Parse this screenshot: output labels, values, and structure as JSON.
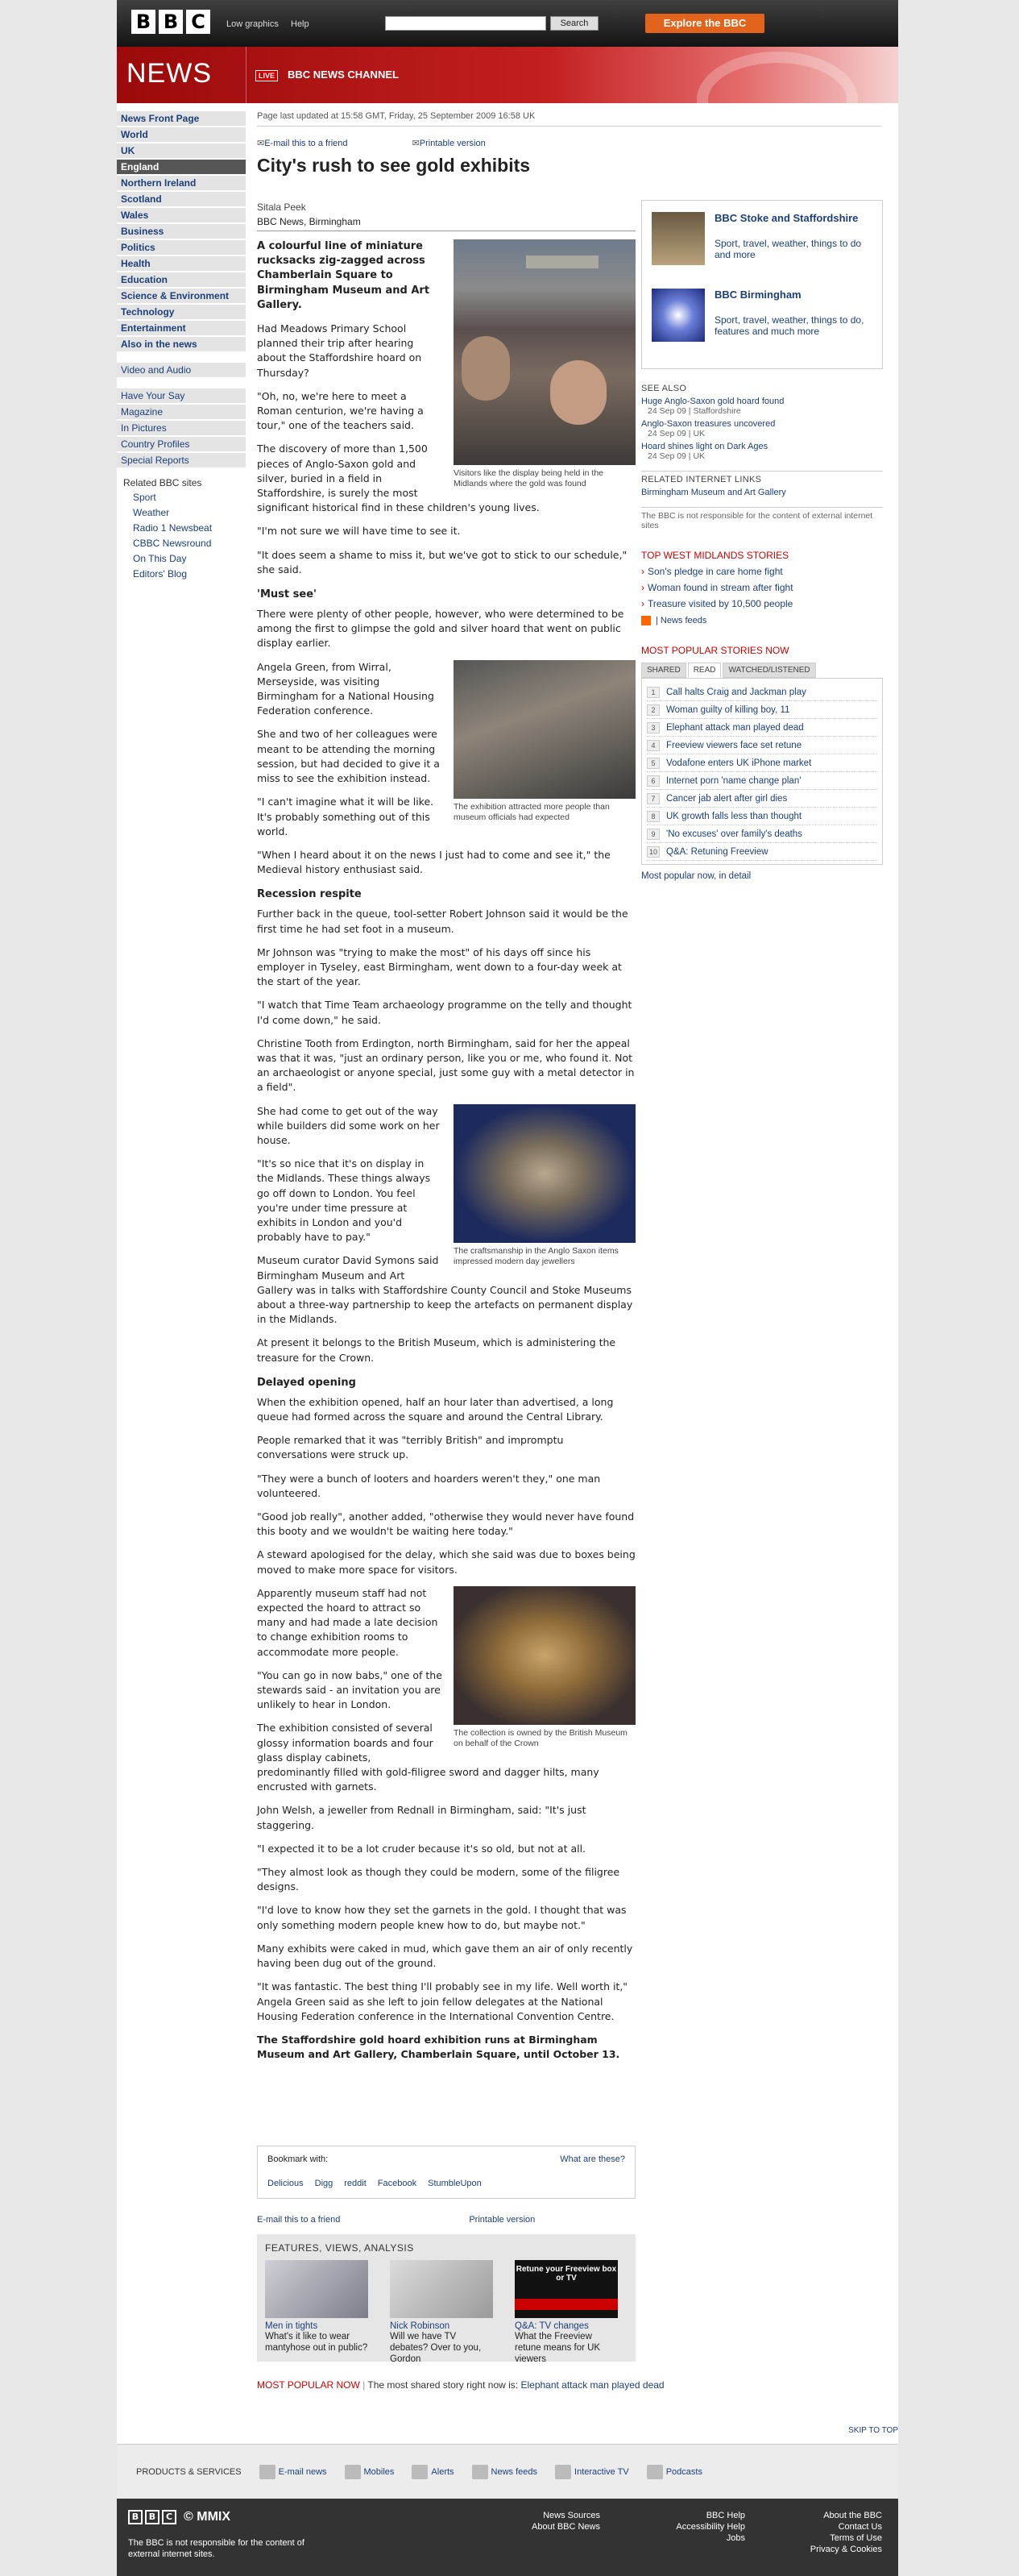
{
  "masthead": {
    "low_graphics": "Low graphics",
    "help": "Help",
    "search_label": "Search",
    "explore": "Explore the BBC"
  },
  "banner": {
    "title": "NEWS",
    "live": "LIVE",
    "channel": "BBC NEWS CHANNEL"
  },
  "nav": {
    "items": [
      "News Front Page",
      "World",
      "UK",
      "England",
      "Northern Ireland",
      "Scotland",
      "Wales",
      "Business",
      "Politics",
      "Health",
      "Education",
      "Science & Environment",
      "Technology",
      "Entertainment",
      "Also in the news"
    ],
    "video": "Video and Audio",
    "secondary": [
      "Have Your Say",
      "Magazine",
      "In Pictures",
      "Country Profiles",
      "Special Reports"
    ],
    "related_header": "Related BBC sites",
    "related": [
      "Sport",
      "Weather",
      "Radio 1 Newsbeat",
      "CBBC Newsround",
      "On This Day",
      "Editors' Blog"
    ]
  },
  "article": {
    "updated": "Page last updated at 15:58 GMT, Friday, 25 September 2009 16:58 UK",
    "email": "E-mail this to a friend",
    "printable": "Printable version",
    "headline": "City's rush to see gold exhibits",
    "author": "Sitala Peek",
    "source": "BBC News, Birmingham",
    "intro": "A colourful line of miniature rucksacks zig-zagged across Chamberlain Square to Birmingham Museum and Art Gallery.",
    "p": [
      "Had Meadows Primary School planned their trip after hearing about the Staffordshire hoard on Thursday?",
      "\"Oh, no, we're here to meet a Roman centurion, we're having a tour,\" one of the teachers said.",
      "The discovery of more than 1,500 pieces of Anglo-Saxon gold and silver, buried in a field in Staffordshire, is surely the most significant historical find in these children's young lives.",
      "\"I'm not sure we will have time to see it.",
      "\"It does seem a shame to miss it, but we've got to stick to our schedule,\" she said."
    ],
    "h1": "'Must see'",
    "p2": [
      "There were plenty of other people, however, who were determined to be among the first to glimpse the gold and silver hoard that went on public display earlier.",
      "Angela Green, from Wirral, Merseyside, was visiting Birmingham for a National Housing Federation conference.",
      "She and two of her colleagues were meant to be attending the morning session, but had decided to give it a miss to see the exhibition instead.",
      "\"I can't imagine what it will be like. It's probably something out of this world.",
      "\"When I heard about it on the news I just had to come and see it,\" the Medieval history enthusiast said."
    ],
    "h2": "Recession respite",
    "p3": [
      "Further back in the queue, tool-setter Robert Johnson said it would be the first time he had set foot in a museum.",
      "Mr Johnson was \"trying to make the most\" of his days off since his employer in Tyseley, east Birmingham, went down to a four-day week at the start of the year.",
      "\"I watch that Time Team archaeology programme on the telly and thought I'd come down,\" he said.",
      "Christine Tooth from Erdington, north Birmingham, said for her the appeal was that it was, \"just an ordinary person, like you or me, who found it. Not an archaeologist or anyone special, just some guy with a metal detector in a field\".",
      "She had come to get out of the way while builders did some work on her house.",
      "\"It's so nice that it's on display in the Midlands. These things always go off down to London. You feel you're under time pressure at exhibits in London and you'd probably have to pay.\"",
      "Museum curator David Symons said Birmingham Museum and Art Gallery was in talks with Staffordshire County Council and Stoke Museums about a three-way partnership to keep the artefacts on permanent display in the Midlands.",
      "At present it belongs to the British Museum, which is administering the treasure for the Crown."
    ],
    "h3": "Delayed opening",
    "p4": [
      "When the exhibition opened, half an hour later than advertised, a long queue had formed across the square and around the Central Library.",
      "People remarked that it was \"terribly British\" and impromptu conversations were struck up.",
      "\"They were a bunch of looters and hoarders weren't they,\" one man volunteered.",
      "\"Good job really\", another added, \"otherwise they would never have found this booty and we wouldn't be waiting here today.\"",
      "A steward apologised for the delay, which she said was due to boxes being moved to make more space for visitors.",
      "Apparently museum staff had not expected the hoard to attract so many and had made a late decision to change exhibition rooms to accommodate more people.",
      "\"You can go in now babs,\" one of the stewards said - an invitation you are unlikely to hear in London.",
      "The exhibition consisted of several glossy information boards and four glass display cabinets, predominantly filled with gold-filigree sword and dagger hilts, many encrusted with garnets.",
      "John Welsh, a jeweller from Rednall in Birmingham, said: \"It's just staggering.",
      "\"I expected it to be a lot cruder because it's so old, but not at all.",
      "\"They almost look as though they could be modern, some of the filigree designs.",
      "\"I'd love to know how they set the garnets in the gold. I thought that was only something modern people knew how to do, but maybe not.\"",
      "Many exhibits were caked in mud, which gave them an air of only recently having been dug out of the ground.",
      "\"It was fantastic. The best thing I'll probably see in my life. Well worth it,\" Angela Green said as she left to join fellow delegates at the National Housing Federation conference in the International Convention Centre."
    ],
    "last": "The Staffordshire gold hoard exhibition runs at Birmingham Museum and Art Gallery, Chamberlain Square, until October 13.",
    "captions": [
      "Visitors like the display being held in the Midlands where the gold was found",
      "The exhibition attracted more people than museum officials had expected",
      "The craftsmanship in the Anglo Saxon items impressed modern day jewellers",
      "The collection is owned by the British Museum on behalf of the Crown"
    ]
  },
  "bookmark": {
    "label": "Bookmark with:",
    "what": "What are these?",
    "sites": [
      "Delicious",
      "Digg",
      "reddit",
      "Facebook",
      "StumbleUpon"
    ]
  },
  "features": {
    "header": "FEATURES, VIEWS, ANALYSIS",
    "items": [
      {
        "title": "Men in tights",
        "sub": "What's it like to wear mantyhose out in public?"
      },
      {
        "title": "Nick Robinson",
        "sub": "Will we have TV debates? Over to you, Gordon"
      },
      {
        "title": "Q&A: TV changes",
        "sub": "What the Freeview retune means for UK viewers",
        "thumb_text": "Retune your Freeview box or TV"
      }
    ]
  },
  "most_popular_now": {
    "label": "MOST POPULAR NOW",
    "text": "The most shared story right now is:",
    "link": "Elephant attack man played dead"
  },
  "sidebar": {
    "local": [
      {
        "title": "BBC Stoke and Staffordshire",
        "sub": "Sport, travel, weather, things to do and more"
      },
      {
        "title": "BBC Birmingham",
        "sub": "Sport, travel, weather, things to do, features and much more"
      }
    ],
    "see_also": "SEE ALSO",
    "see_also_items": [
      {
        "title": "Huge Anglo-Saxon gold hoard found",
        "meta": "24 Sep 09 |  Staffordshire"
      },
      {
        "title": "Anglo-Saxon treasures uncovered",
        "meta": "24 Sep 09 |  UK"
      },
      {
        "title": "Hoard shines light on Dark Ages",
        "meta": "24 Sep 09 |  UK"
      }
    ],
    "internet_links": "RELATED INTERNET LINKS",
    "internet_items": [
      "Birmingham Museum and Art Gallery"
    ],
    "disclaimer": "The BBC is not responsible for the content of external internet sites",
    "top_header": "TOP WEST MIDLANDS STORIES",
    "top_items": [
      "Son's pledge in care home fight",
      "Woman found in stream after fight",
      "Treasure visited by 10,500 people"
    ],
    "news_feeds": "| News feeds",
    "mp_header": "MOST POPULAR STORIES NOW",
    "mp_tabs": [
      "SHARED",
      "READ",
      "WATCHED/LISTENED"
    ],
    "mp_items": [
      "Call halts Craig and Jackman play",
      "Woman guilty of killing boy, 11",
      "Elephant attack man played dead",
      "Freeview viewers face set retune",
      "Vodafone enters UK iPhone market",
      "Internet porn 'name change plan'",
      "Cancer jab alert after girl dies",
      "UK growth falls less than thought",
      "'No excuses' over family's deaths",
      "Q&A: Retuning Freeview"
    ],
    "mp_more": "Most popular now, in detail"
  },
  "footer": {
    "skip": "SKIP TO TOP",
    "ps": "PRODUCTS & SERVICES",
    "ps_items": [
      "E-mail news",
      "Mobiles",
      "Alerts",
      "News feeds",
      "Interactive TV",
      "Podcasts"
    ],
    "mmix": "© MMIX",
    "note": "The BBC is not responsible for the content of external internet sites.",
    "col1": [
      "News Sources",
      "About BBC News"
    ],
    "col2": [
      "BBC Help",
      "Accessibility Help",
      "Jobs"
    ],
    "col3": [
      "About the BBC",
      "Contact Us",
      "Terms of Use",
      "Privacy & Cookies"
    ]
  }
}
